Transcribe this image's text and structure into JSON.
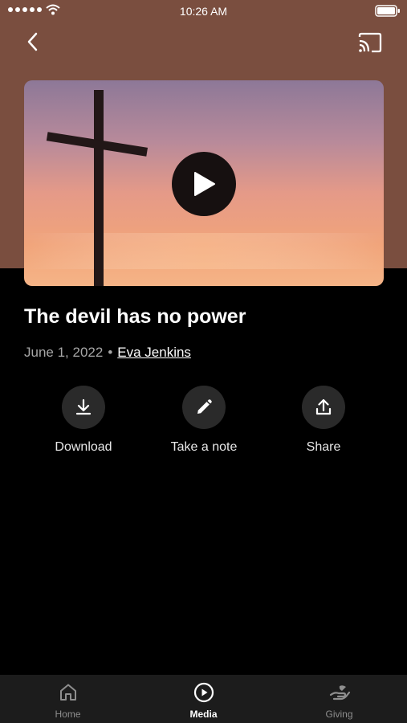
{
  "status_bar": {
    "time": "10:26 AM"
  },
  "media": {
    "title": "The devil has no power",
    "date": "June 1, 2022",
    "separator": "•",
    "author": "Eva Jenkins"
  },
  "actions": [
    {
      "label": "Download",
      "icon": "download-icon"
    },
    {
      "label": "Take a note",
      "icon": "pencil-icon"
    },
    {
      "label": "Share",
      "icon": "share-icon"
    }
  ],
  "tabs": [
    {
      "label": "Home",
      "icon": "home-icon",
      "active": false
    },
    {
      "label": "Media",
      "icon": "play-circle-icon",
      "active": true
    },
    {
      "label": "Giving",
      "icon": "giving-hand-icon",
      "active": false
    }
  ],
  "colors": {
    "header_bg": "#7a4e3f",
    "background": "#000000",
    "tabbar_bg": "#1c1c1c"
  }
}
